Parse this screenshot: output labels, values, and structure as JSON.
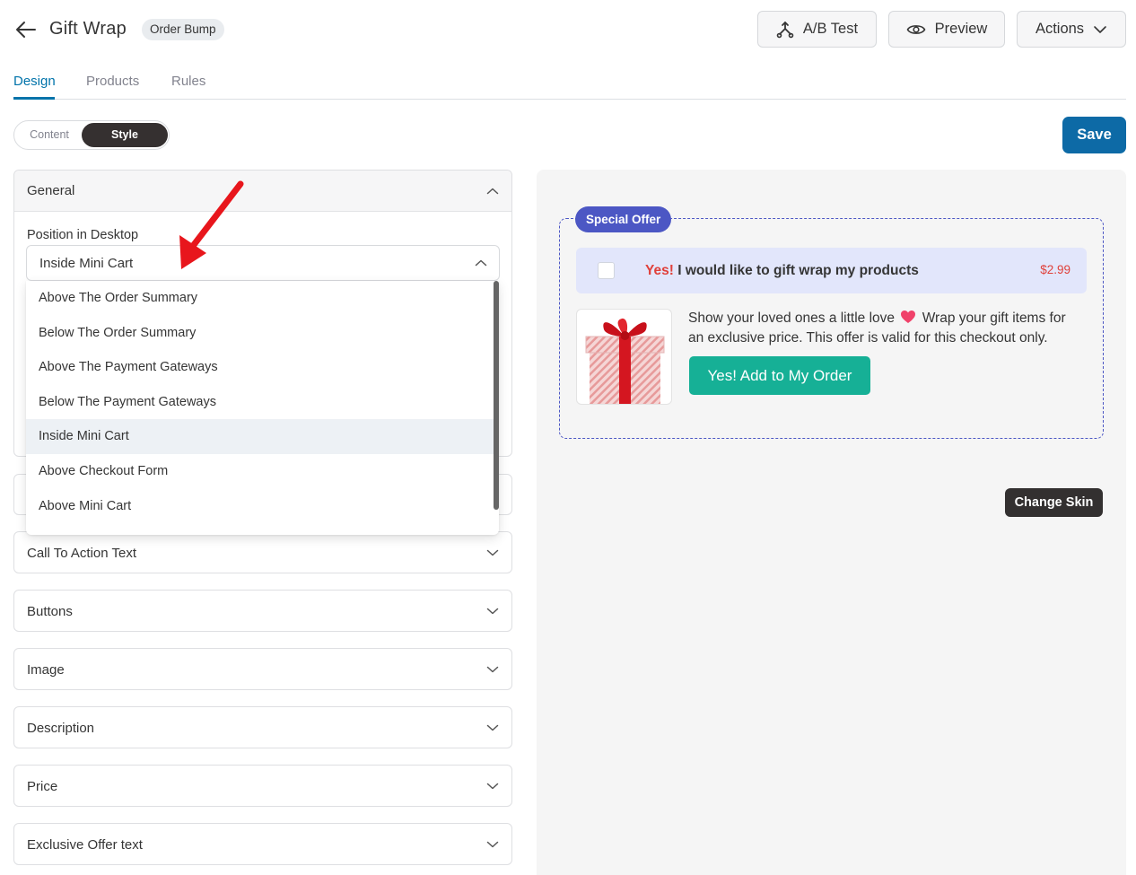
{
  "header": {
    "title": "Gift Wrap",
    "badge": "Order Bump",
    "ab_test_label": "A/B Test",
    "preview_label": "Preview",
    "actions_label": "Actions"
  },
  "tabs": [
    {
      "label": "Design",
      "active": true
    },
    {
      "label": "Products",
      "active": false
    },
    {
      "label": "Rules",
      "active": false
    }
  ],
  "toggle": {
    "content_label": "Content",
    "style_label": "Style",
    "selected": "Style"
  },
  "save_label": "Save",
  "general": {
    "title": "General",
    "position_label": "Position in Desktop",
    "selected_value": "Inside Mini Cart",
    "options": [
      "Above The Order Summary",
      "Below The Order Summary",
      "Above The Payment Gateways",
      "Below The Payment Gateways",
      "Inside Mini Cart",
      "Above Checkout Form",
      "Above Mini Cart"
    ]
  },
  "sections": [
    "Call To Action Text",
    "Buttons",
    "Image",
    "Description",
    "Price",
    "Exclusive Offer text"
  ],
  "preview": {
    "badge": "Special Offer",
    "offer_yes": "Yes!",
    "offer_text": "I would like to gift wrap my products",
    "price": "$2.99",
    "desc_part1": "Show your loved ones a little love",
    "desc_part2": "Wrap your gift items for an exclusive price. This offer is valid for this checkout only.",
    "add_button": "Yes! Add to My Order",
    "change_skin": "Change Skin"
  },
  "colors": {
    "accent": "#0d6aa6",
    "tab_active": "#0073aa",
    "bump_border": "#4c57c4",
    "offer_bg": "#e2e6fb",
    "yes_red": "#e0403a",
    "add_button": "#16b096",
    "dark": "#333030"
  }
}
